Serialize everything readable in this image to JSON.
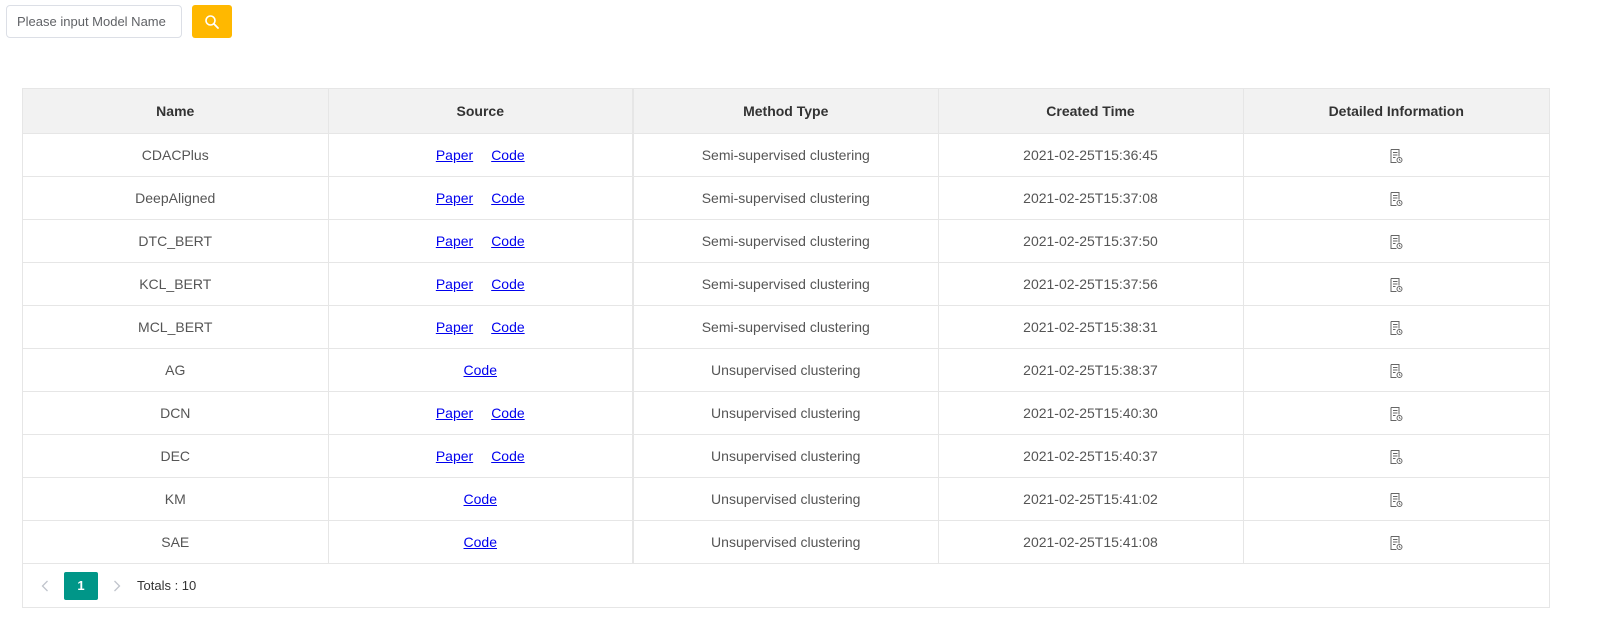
{
  "search": {
    "placeholder": "Please input Model Name",
    "value": ""
  },
  "colors": {
    "search_button": "#ffb800",
    "pagination_active": "#009688",
    "link": "#0000ee",
    "header_bg": "#f2f2f2"
  },
  "table": {
    "headers": [
      "Name",
      "Source",
      "Method Type",
      "Created Time",
      "Detailed Information"
    ],
    "rows": [
      {
        "name": "CDACPlus",
        "source": [
          "Paper",
          "Code"
        ],
        "method_type": "Semi-supervised clustering",
        "created_time": "2021-02-25T15:36:45",
        "detail_icon": "document-icon"
      },
      {
        "name": "DeepAligned",
        "source": [
          "Paper",
          "Code"
        ],
        "method_type": "Semi-supervised clustering",
        "created_time": "2021-02-25T15:37:08",
        "detail_icon": "document-icon"
      },
      {
        "name": "DTC_BERT",
        "source": [
          "Paper",
          "Code"
        ],
        "method_type": "Semi-supervised clustering",
        "created_time": "2021-02-25T15:37:50",
        "detail_icon": "document-icon"
      },
      {
        "name": "KCL_BERT",
        "source": [
          "Paper",
          "Code"
        ],
        "method_type": "Semi-supervised clustering",
        "created_time": "2021-02-25T15:37:56",
        "detail_icon": "document-icon"
      },
      {
        "name": "MCL_BERT",
        "source": [
          "Paper",
          "Code"
        ],
        "method_type": "Semi-supervised clustering",
        "created_time": "2021-02-25T15:38:31",
        "detail_icon": "document-icon"
      },
      {
        "name": "AG",
        "source": [
          "Code"
        ],
        "method_type": "Unsupervised clustering",
        "created_time": "2021-02-25T15:38:37",
        "detail_icon": "document-icon"
      },
      {
        "name": "DCN",
        "source": [
          "Paper",
          "Code"
        ],
        "method_type": "Unsupervised clustering",
        "created_time": "2021-02-25T15:40:30",
        "detail_icon": "document-icon"
      },
      {
        "name": "DEC",
        "source": [
          "Paper",
          "Code"
        ],
        "method_type": "Unsupervised clustering",
        "created_time": "2021-02-25T15:40:37",
        "detail_icon": "document-icon"
      },
      {
        "name": "KM",
        "source": [
          "Code"
        ],
        "method_type": "Unsupervised clustering",
        "created_time": "2021-02-25T15:41:02",
        "detail_icon": "document-icon"
      },
      {
        "name": "SAE",
        "source": [
          "Code"
        ],
        "method_type": "Unsupervised clustering",
        "created_time": "2021-02-25T15:41:08",
        "detail_icon": "document-icon"
      }
    ]
  },
  "pagination": {
    "current_page": "1",
    "total_text": "Totals : 10"
  }
}
